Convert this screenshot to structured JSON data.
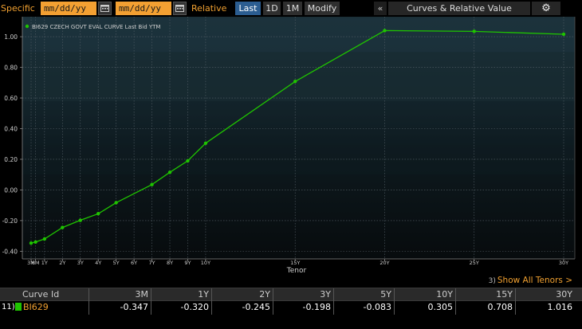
{
  "toolbar": {
    "specific_label": "Specific",
    "start_date_placeholder": "mm/dd/yy",
    "end_date_placeholder": "mm/dd/yy",
    "relative_label": "Relative",
    "last_button": "Last",
    "d1_button": "1D",
    "m1_button": "1M",
    "modify_button": "Modify",
    "collapse_glyph": "«",
    "title": "Curves & Relative Value",
    "settings_glyph": "⚙"
  },
  "colors": {
    "accent_orange": "#f3a032",
    "series_green": "#1fc400",
    "active_button": "#2b5d91"
  },
  "chart_data": {
    "type": "line",
    "legend": "BI629 CZECH GOVT EVAL CURVE Last Bid YTM",
    "legend_position": "top-left",
    "xlabel": "Tenor",
    "x_unit": "years",
    "ylim": [
      -0.45,
      1.12
    ],
    "yticks": [
      -0.4,
      -0.2,
      0.0,
      0.2,
      0.4,
      0.6,
      0.8,
      1.0
    ],
    "ytick_labels": [
      "-0.40",
      "-0.20",
      "0.00",
      "0.20",
      "0.40",
      "0.60",
      "0.80",
      "1.00"
    ],
    "xticks": [
      0.25,
      0.5,
      1,
      2,
      3,
      4,
      5,
      6,
      7,
      8,
      9,
      10,
      15,
      20,
      25,
      30
    ],
    "xtick_labels": [
      "3M",
      "6M",
      "1Y",
      "2Y",
      "3Y",
      "4Y",
      "5Y",
      "6Y",
      "7Y",
      "8Y",
      "9Y",
      "10Y",
      "15Y",
      "20Y",
      "25Y",
      "30Y"
    ],
    "grid": true,
    "series": [
      {
        "name": "BI629 CZECH GOVT EVAL CURVE Last Bid YTM",
        "color": "#1fc400",
        "x": [
          0.25,
          0.5,
          1,
          2,
          3,
          4,
          5,
          7,
          8,
          9,
          10,
          15,
          20,
          25,
          30
        ],
        "values": [
          -0.347,
          -0.34,
          -0.32,
          -0.245,
          -0.198,
          -0.155,
          -0.083,
          0.035,
          0.115,
          0.19,
          0.305,
          0.708,
          1.04,
          1.035,
          1.016
        ]
      }
    ]
  },
  "show_all": {
    "number": "3)",
    "label": "Show All Tenors >"
  },
  "table": {
    "headers": [
      "Curve Id",
      "3M",
      "1Y",
      "2Y",
      "3Y",
      "5Y",
      "10Y",
      "15Y",
      "30Y"
    ],
    "rows": [
      {
        "index": "11)",
        "id": "BI629",
        "values": [
          "-0.347",
          "-0.320",
          "-0.245",
          "-0.198",
          "-0.083",
          "0.305",
          "0.708",
          "1.016"
        ]
      }
    ]
  }
}
